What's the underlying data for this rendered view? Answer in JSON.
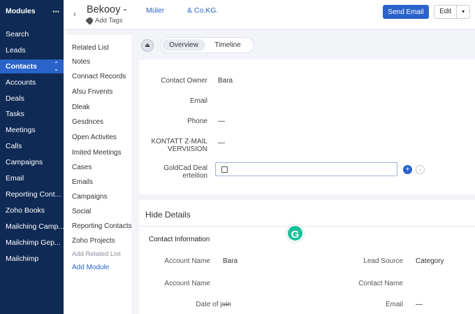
{
  "nav": {
    "header": "Modules",
    "more_icon": "···",
    "items": [
      {
        "label": "Search"
      },
      {
        "label": "Leads"
      },
      {
        "label": "Contacts",
        "active": true
      },
      {
        "label": "Accounts"
      },
      {
        "label": "Deals"
      },
      {
        "label": "Tasks"
      },
      {
        "label": "Meetings"
      },
      {
        "label": "Calls"
      },
      {
        "label": "Campaigns"
      },
      {
        "label": "Email"
      },
      {
        "label": "Reporting Cont..."
      },
      {
        "label": "Zoho Books"
      },
      {
        "label": "Mailching Camp..."
      },
      {
        "label": "Mailchimp Gep..."
      },
      {
        "label": "Mailchimp"
      }
    ]
  },
  "related": {
    "items": [
      "Related List",
      "Notes",
      "Connact Records",
      "Afsu Fnvents",
      "Dleak",
      "Gesdnces",
      "Open Activites",
      "Imited Meetings",
      "Cases",
      "Emails",
      "Campaigns",
      "Social",
      "Reporting Contacts",
      "Zoho Projects"
    ],
    "add_related": "Add Related List",
    "add_module": "Add Module"
  },
  "header": {
    "title": "Bekooy -",
    "title_part2": "Müler",
    "title_part3": "& Co.KG.",
    "add_tags": "Add Tags",
    "send_email": "Send Email",
    "edit": "Edit"
  },
  "tabs": {
    "overview": "Overview",
    "timeline": "Timeline"
  },
  "contact_fields": {
    "owner_label": "Contact Owner",
    "owner_value": "Bara",
    "email_label": "Email",
    "phone_label": "Phone",
    "phone_value": "—",
    "kontatt_label_1": "KONTATT Z-MAIL",
    "kontatt_label_2": "VERVIISION",
    "kontatt_value": "—",
    "goldcad_label_1": "GoldCad Deal",
    "goldcad_label_2": "erteition"
  },
  "details": {
    "hide_details": "Hide Details",
    "section_title": "Contact Information",
    "rows": [
      {
        "l1": "Account Name",
        "v1": "Bara",
        "l2": "Lead Source",
        "v2": "Category"
      },
      {
        "l1": "Account Name",
        "v1": "",
        "l2": "Contact Name",
        "v2": ""
      },
      {
        "l1": "Date of join",
        "v1": "—",
        "l2": "Email",
        "v2": "—"
      }
    ]
  },
  "colors": {
    "nav_bg": "#0f2a55",
    "accent": "#2a63c9",
    "grammarly": "#15c39a"
  }
}
